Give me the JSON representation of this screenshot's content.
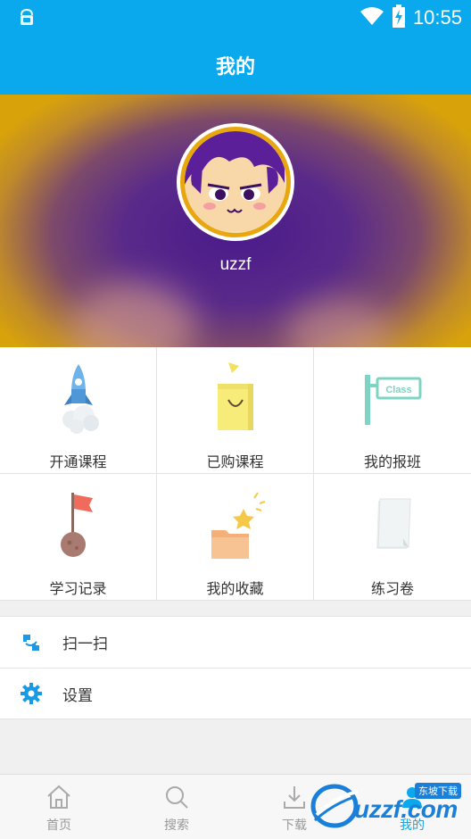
{
  "status_bar": {
    "time": "10:55",
    "icons": [
      "notification-icon",
      "wifi-icon",
      "battery-charging-icon"
    ]
  },
  "header": {
    "title": "我的"
  },
  "profile": {
    "username": "uzzf"
  },
  "grid": {
    "items": [
      {
        "label": "开通课程",
        "icon": "rocket-icon"
      },
      {
        "label": "已购课程",
        "icon": "shopping-bag-icon"
      },
      {
        "label": "我的报班",
        "icon": "class-sign-icon",
        "sign_text": "Class"
      },
      {
        "label": "学习记录",
        "icon": "flag-icon"
      },
      {
        "label": "我的收藏",
        "icon": "folder-star-icon"
      },
      {
        "label": "练习卷",
        "icon": "paper-icon"
      }
    ]
  },
  "menu": {
    "items": [
      {
        "label": "扫一扫",
        "icon": "scan-icon"
      },
      {
        "label": "设置",
        "icon": "gear-icon"
      }
    ]
  },
  "tabbar": {
    "tabs": [
      {
        "label": "首页",
        "icon": "home-icon",
        "active": false
      },
      {
        "label": "搜索",
        "icon": "search-icon",
        "active": false
      },
      {
        "label": "下载",
        "icon": "download-icon",
        "active": false
      },
      {
        "label": "我的",
        "icon": "user-icon",
        "active": true
      }
    ]
  },
  "watermark": {
    "text": "uzzf.com",
    "badge": "东坡下载"
  },
  "colors": {
    "primary": "#0aa8ec",
    "avatar_ring": "#e8a70e",
    "text": "#333333",
    "tab_inactive": "#999999"
  }
}
